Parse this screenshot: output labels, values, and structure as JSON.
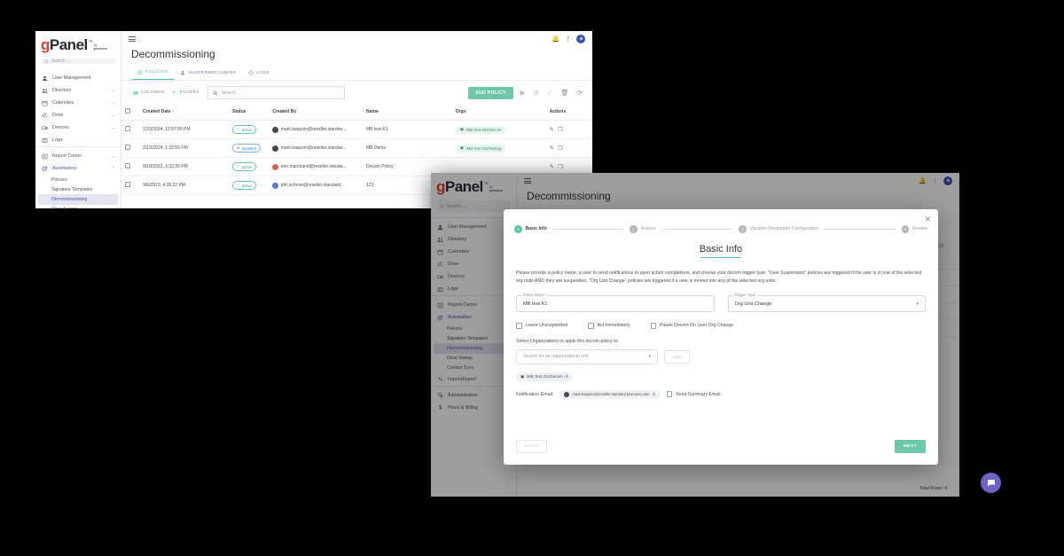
{
  "brand": {
    "logo_g": "g",
    "logo_panel": "Panel",
    "logo_tm": "™",
    "logo_by": "by",
    "logo_company": "promevo",
    "accent_teal": "#6fc7ab",
    "accent_purple": "#4b4fa6",
    "logo_red": "#e03a32"
  },
  "sidebar": {
    "search_placeholder": "Search ...",
    "items": [
      {
        "label": "User Management",
        "icon": "person-icon",
        "expandable": false
      },
      {
        "label": "Directory",
        "icon": "people-icon",
        "expandable": true
      },
      {
        "label": "Calendars",
        "icon": "calendar-icon",
        "expandable": true
      },
      {
        "label": "Drive",
        "icon": "drive-icon",
        "expandable": true
      },
      {
        "label": "Devices",
        "icon": "devices-icon",
        "expandable": true
      },
      {
        "label": "Logs",
        "icon": "logs-icon",
        "expandable": false
      },
      {
        "label": "Report Center",
        "icon": "report-icon",
        "expandable": true
      },
      {
        "label": "Automation",
        "icon": "gear-icon",
        "expandable": true,
        "expanded": true
      }
    ],
    "automation_children": [
      {
        "label": "Policies",
        "selected": false
      },
      {
        "label": "Signature Templates",
        "selected": false
      },
      {
        "label": "Decommissioning",
        "selected": true
      },
      {
        "label": "Drive Sweep",
        "selected": false
      },
      {
        "label": "Contact Sync",
        "selected": false
      }
    ],
    "bottom_items": [
      {
        "label": "Import/Export",
        "icon": "import-export-icon",
        "expandable": true
      },
      {
        "label": "Administration",
        "icon": "admin-gear-icon",
        "expandable": true
      },
      {
        "label": "Plans & Billing",
        "icon": "dollar-icon",
        "expandable": false
      }
    ]
  },
  "topbar": {
    "notifications_icon": "bell-icon",
    "more_icon": "kebab-menu-icon",
    "avatar": "user-avatar"
  },
  "page": {
    "title": "Decommissioning"
  },
  "tabs": [
    {
      "label": "POLICIES",
      "icon": "shield-icon",
      "active": true
    },
    {
      "label": "SUSPENDED USERS",
      "icon": "person-off-icon",
      "active": false
    },
    {
      "label": "LOGS",
      "icon": "history-icon",
      "active": false
    }
  ],
  "toolbar": {
    "columns_label": "COLUMNS",
    "filters_label": "FILTERS",
    "search_placeholder": "Search...",
    "add_policy_label": "ADD POLICY",
    "icons": [
      "play-icon",
      "block-icon",
      "check-icon",
      "trash-icon",
      "refresh-icon"
    ]
  },
  "table": {
    "columns": [
      "Created Date",
      "Status",
      "Created By",
      "Name",
      "Orgs",
      "Actions"
    ],
    "sort_column": "Created Date",
    "sort_direction": "desc",
    "rows": [
      {
        "created_date": "12/3/2024, 12:57:55 PM",
        "status": "active",
        "created_by": "mark.baquirin@reseller.standar...",
        "name": "MB test K1",
        "org": "/MB Test OU/Decom",
        "avatar_color": "dark"
      },
      {
        "created_date": "2/13/2024, 1:32:55 PM",
        "status": "disabled",
        "created_by": "mark.baquirin@reseller.standar...",
        "name": "MB Demo",
        "org": "/MB Test OU/Testing",
        "avatar_color": "dark"
      },
      {
        "created_date": "9/18/2023, 3:32:35 PM",
        "status": "active",
        "created_by": "erin.marchand@reseller.standa...",
        "name": "Decom Policy",
        "org": "",
        "avatar_color": "orange"
      },
      {
        "created_date": "9/6/2023, 4:35:22 PM",
        "status": "active",
        "created_by": "phil.schnee@reseller.standard...",
        "name": "123",
        "org": "",
        "avatar_color": "blue"
      }
    ],
    "total_rows_label": "Total Rows: 4"
  },
  "modal": {
    "close_icon": "close-icon",
    "steps": [
      {
        "num": "1",
        "label": "Basic Info",
        "state": "current"
      },
      {
        "num": "2",
        "label": "Actions",
        "state": "pending"
      },
      {
        "num": "3",
        "label": "Vacation Responder Configuration",
        "state": "pending"
      },
      {
        "num": "4",
        "label": "Review",
        "state": "pending"
      }
    ],
    "title": "Basic Info",
    "description": "Please provide a policy name, a user to send notifications to upon action completions, and choose your decom trigger type. \"User Suspension\" policies are triggered if the user is in one of the selected org units AND they are suspended. \"Org Unit Change\" policies are triggered if a user is moved into any of the selected org units.",
    "policy_name_label": "Policy Name *",
    "policy_name_value": "MB test K1",
    "trigger_type_label": "Trigger Type",
    "trigger_type_value": "Org Unit Change",
    "checkboxes": [
      {
        "label": "Leave Unsuspended",
        "checked": false
      },
      {
        "label": "Act Immediately",
        "checked": false
      },
      {
        "label": "Pause Decom On User Org Change",
        "checked": false
      }
    ],
    "org_section_label": "Select Organizations to apply this decom policy to:",
    "org_search_placeholder": "Search for an organizational unit",
    "add_button_label": "ADD",
    "selected_org": "/MB Test OU/Decom",
    "notification_email_label": "Notification Email:",
    "notification_email_value": "mark.baquirin@reseller.standard.promevo.com",
    "send_summary_label": "Send Summary Email",
    "send_summary_checked": false,
    "back_label": "BACK",
    "next_label": "NEXT"
  },
  "fab": {
    "icon": "chat-bubble-icon"
  }
}
